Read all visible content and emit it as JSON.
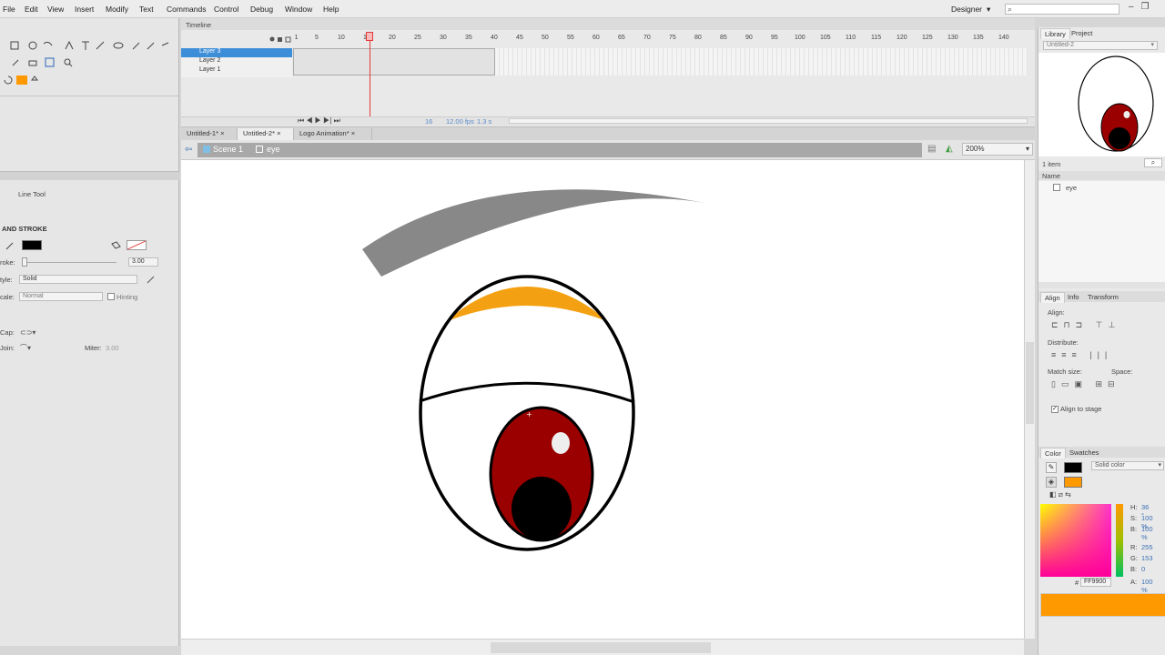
{
  "menu": {
    "items": [
      "File",
      "Edit",
      "View",
      "Insert",
      "Modify",
      "Text",
      "Commands",
      "Control",
      "Debug",
      "Window",
      "Help"
    ],
    "workspace": "Designer",
    "search_placeholder": ""
  },
  "timeline": {
    "title": "Timeline",
    "layers": [
      "Layer 3",
      "Layer 2",
      "Layer 1"
    ],
    "selected_layer": "Layer 3",
    "frame_numbers": [
      "1",
      "5",
      "10",
      "15",
      "20",
      "25",
      "30",
      "35",
      "40",
      "45",
      "50",
      "55",
      "60",
      "65",
      "70",
      "75",
      "80",
      "85",
      "90",
      "95",
      "100",
      "105",
      "110",
      "115",
      "120",
      "125",
      "130",
      "135",
      "140"
    ],
    "current_frame": "16",
    "fps": "12.00 fps",
    "elapsed": "1.3 s"
  },
  "doc_tabs": [
    {
      "label": "Untitled-1*",
      "active": false
    },
    {
      "label": "Untitled-2*",
      "active": true
    },
    {
      "label": "Logo Animation*",
      "active": false
    }
  ],
  "edit_bar": {
    "scene": "Scene 1",
    "symbol": "eye",
    "zoom": "200%"
  },
  "properties": {
    "tool_name": "Line Tool",
    "section": "AND STROKE",
    "stroke_label": "roke:",
    "stroke_value": "3.00",
    "style_label": "tyle:",
    "style_value": "Solid",
    "scale_label": "cale:",
    "scale_value": "Normal",
    "hinting_label": "Hinting",
    "cap_label": "Cap:",
    "join_label": "Join:",
    "miter_label": "Miter:",
    "miter_value": "3.00",
    "stroke_color": "#000000",
    "fill_color": "#ff9900"
  },
  "library": {
    "tabs": [
      "Library",
      "Project"
    ],
    "document": "Untitled-2",
    "item_count": "1 item",
    "column_name": "Name",
    "items": [
      "eye"
    ]
  },
  "align": {
    "tabs": [
      "Align",
      "Info",
      "Transform"
    ],
    "align_label": "Align:",
    "distribute_label": "Distribute:",
    "match_size_label": "Match size:",
    "space_label": "Space:",
    "align_to_stage": "Align to stage"
  },
  "color": {
    "tabs": [
      "Color",
      "Swatches"
    ],
    "type": "Solid color",
    "h_label": "H:",
    "h": "36 °",
    "s_label": "S:",
    "s": "100 %",
    "b_label": "B:",
    "b": "100 %",
    "r_label": "R:",
    "r": "255",
    "g_label": "G:",
    "g": "153",
    "bl_label": "B:",
    "bl": "0",
    "a_label": "A:",
    "a": "100 %",
    "hex": "FF9900",
    "hex_prefix": "#",
    "current": "#ff9900"
  }
}
